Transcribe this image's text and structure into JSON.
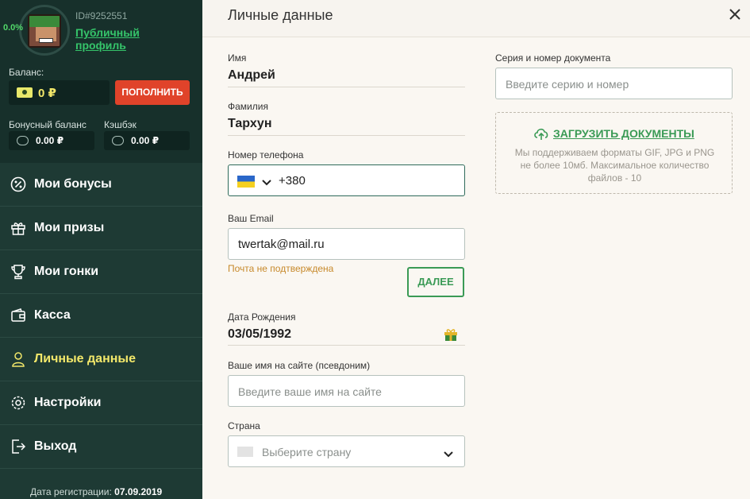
{
  "profile": {
    "progress": "0.0%",
    "user_id": "ID#9252551",
    "public_profile": "Публичный профиль",
    "balance_label": "Баланс:",
    "balance_value": "0 ₽",
    "topup_label": "ПОПОЛНИТЬ",
    "bonus_label": "Бонусный баланс",
    "bonus_value": "0.00 ₽",
    "cashback_label": "Кэшбэк",
    "cashback_value": "0.00 ₽"
  },
  "menu": {
    "items": [
      {
        "label": "Мои бонусы",
        "icon": "percent-icon"
      },
      {
        "label": "Мои призы",
        "icon": "gift-icon"
      },
      {
        "label": "Мои гонки",
        "icon": "trophy-icon"
      },
      {
        "label": "Касса",
        "icon": "wallet-icon"
      },
      {
        "label": "Личные данные",
        "icon": "user-icon"
      },
      {
        "label": "Настройки",
        "icon": "gear-icon"
      },
      {
        "label": "Выход",
        "icon": "logout-icon"
      }
    ],
    "active_index": 4
  },
  "registration": {
    "label": "Дата регистрации:",
    "date": "07.09.2019"
  },
  "main": {
    "title": "Личные данные",
    "first_name_label": "Имя",
    "first_name": "Андрей",
    "last_name_label": "Фамилия",
    "last_name": "Тархун",
    "phone_label": "Номер телефона",
    "phone_value": "+380",
    "email_label": "Ваш Email",
    "email_value": "twertak@mail.ru",
    "email_warning": "Почта не подтверждена",
    "next_label": "ДАЛЕЕ",
    "birth_label": "Дата Рождения",
    "birth_value": "03/05/1992",
    "nickname_label": "Ваше имя на сайте (псевдоним)",
    "nickname_placeholder": "Введите ваше имя на сайте",
    "country_label": "Страна",
    "country_placeholder": "Выберите страну",
    "doc_label": "Серия и номер документа",
    "doc_placeholder": "Введите серию и номер",
    "upload_label": "ЗАГРУЗИТЬ ДОКУМЕНТЫ",
    "upload_hint": "Мы поддерживаем форматы GIF, JPG и PNG не более 10мб. Максимальное количество файлов - 10"
  },
  "colors": {
    "sidebar": "#1e3a34",
    "accent_green": "#3a9a55",
    "topup_red": "#e0432a",
    "active_yellow": "#f3e86a"
  }
}
